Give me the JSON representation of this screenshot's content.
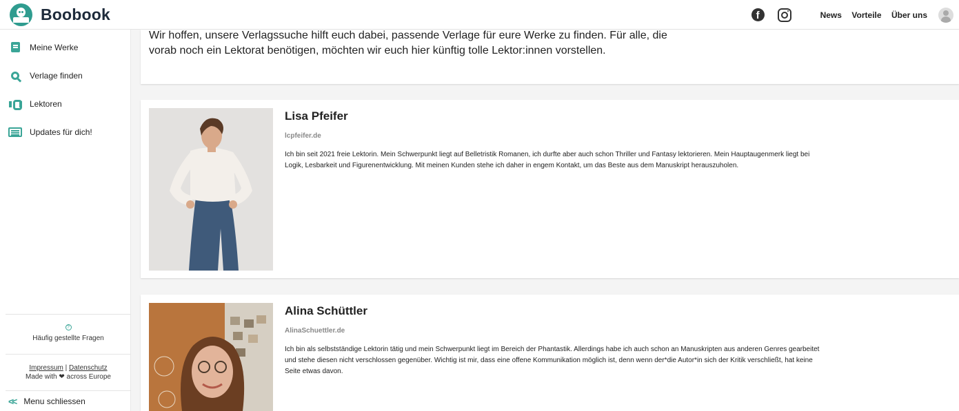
{
  "header": {
    "logo_text": "Boobook",
    "nav": [
      "News",
      "Vorteile",
      "Über uns"
    ],
    "social": [
      "facebook-icon",
      "instagram-icon"
    ]
  },
  "sidebar": {
    "items": [
      {
        "label": "Meine Werke",
        "icon": "book-icon"
      },
      {
        "label": "Verlage finden",
        "icon": "search-icon"
      },
      {
        "label": "Lektoren",
        "icon": "handshake-icon"
      },
      {
        "label": "Updates für dich!",
        "icon": "list-icon"
      }
    ],
    "faq_label": "Häufig gestellte Fragen",
    "faq_icon": "?",
    "impressum": "Impressum",
    "separator": "|",
    "datenschutz": "Datenschutz",
    "made_with": "Made with",
    "heart": "❤",
    "across": "across Europe",
    "close_chev": "<<",
    "close_label": "Menu schliessen"
  },
  "intro": {
    "text": "Wir hoffen, unsere Verlagssuche hilft euch dabei, passende Verlage für eure Werke zu finden. Für alle, die vorab noch ein Lektorat benötigen, möchten wir euch hier künftig tolle Lektor:innen vorstellen."
  },
  "editors": [
    {
      "name": "Lisa Pfeifer",
      "site": "lcpfeifer.de",
      "description": "Ich bin seit 2021 freie Lektorin. Mein Schwerpunkt liegt auf Belletristik Romanen, ich durfte aber auch schon Thriller und Fantasy lektorieren. Mein Hauptaugenmerk liegt bei Logik, Lesbarkeit und Figurenentwicklung. Mit meinen Kunden stehe ich daher in engem Kontakt, um das Beste aus dem Manuskript herauszuholen."
    },
    {
      "name": "Alina Schüttler",
      "site": "AlinaSchuettler.de",
      "description": "Ich bin als selbstständige Lektorin tätig und mein Schwerpunkt liegt im Bereich der Phantastik. Allerdings habe ich auch schon an Manuskripten aus anderen Genres gearbeitet und stehe diesen nicht verschlossen gegenüber. Wichtig ist mir, dass eine offene Kommunikation möglich ist, denn wenn der*die Autor*in sich der Kritik verschließt, hat keine Seite etwas davon."
    }
  ],
  "colors": {
    "accent": "#3aa597",
    "logo": "#2f9c8f"
  }
}
